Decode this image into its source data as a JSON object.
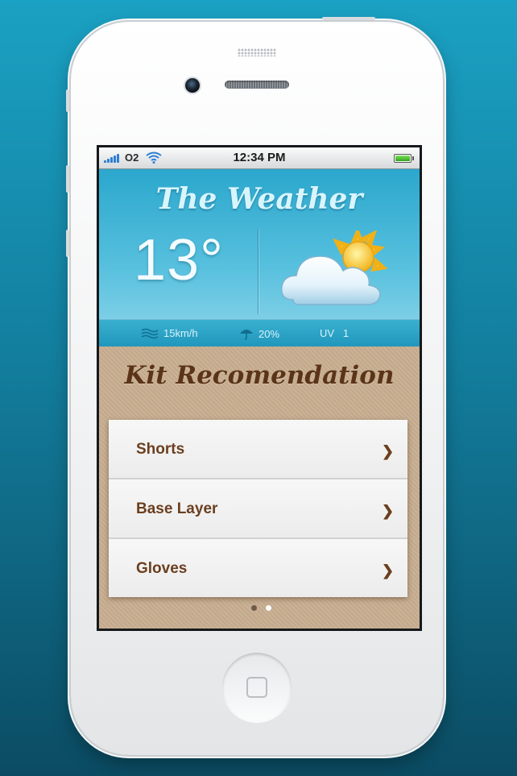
{
  "status_bar": {
    "carrier": "O2",
    "time": "12:34 PM"
  },
  "weather": {
    "title": "The Weather",
    "temperature": "13°",
    "condition_icon": "partly-cloudy-icon",
    "wind": "15km/h",
    "precipitation": "20%",
    "uv_label": "UV",
    "uv_value": "1"
  },
  "kit": {
    "title": "Kit Recomendation",
    "items": [
      {
        "label": "Shorts"
      },
      {
        "label": "Base Layer"
      },
      {
        "label": "Gloves"
      }
    ]
  },
  "pager": {
    "page_count": 2,
    "active_page": 2
  },
  "colors": {
    "sky": "#2ba7cd",
    "sand": "#c8ae91",
    "brown_text": "#6b3f1f",
    "title_brown": "#5b3418"
  }
}
